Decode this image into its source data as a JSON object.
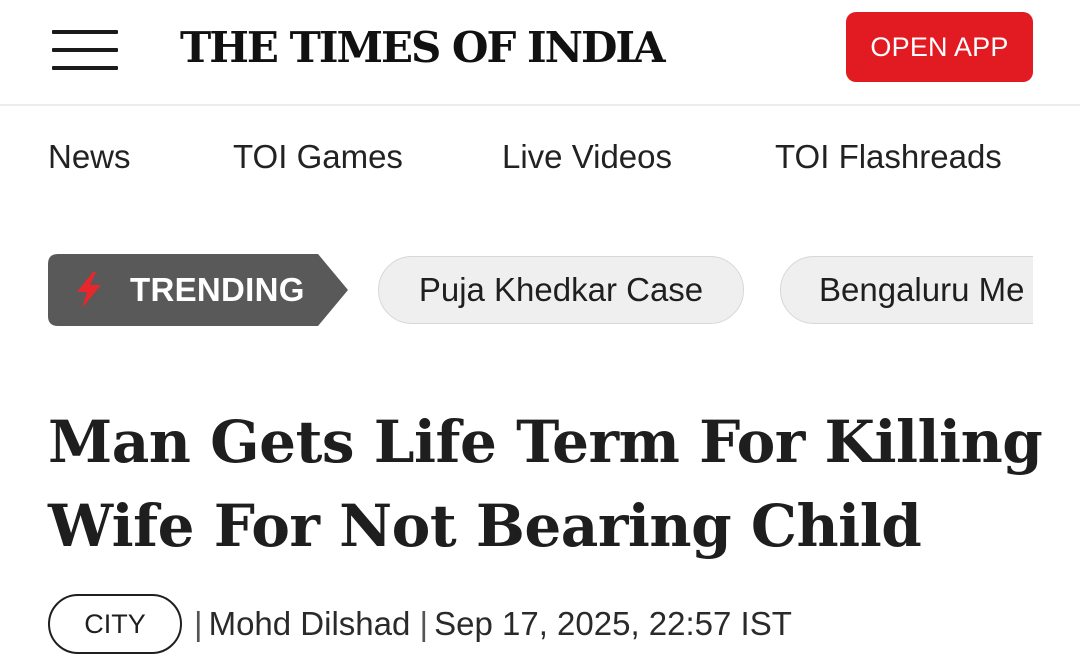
{
  "header": {
    "logo_text": "THE TIMES OF INDIA",
    "open_app_label": "OPEN APP",
    "menu_icon": "hamburger-menu-icon"
  },
  "subnav": {
    "items": [
      {
        "label": "News"
      },
      {
        "label": "TOI Games"
      },
      {
        "label": "Live Videos"
      },
      {
        "label": "TOI Flashreads"
      }
    ]
  },
  "trending": {
    "label": "TRENDING",
    "icon": "lightning-bolt-icon",
    "chips": [
      {
        "label": "Puja Khedkar Case"
      },
      {
        "label": "Bengaluru Me"
      }
    ]
  },
  "article": {
    "headline_line1": "Man Gets Life Term For Killing",
    "headline_line2": "Wife For Not Bearing Child",
    "category": "CITY",
    "author": "Mohd Dilshad",
    "separator": "|",
    "timestamp": "Sep 17, 2025, 22:57 IST"
  },
  "colors": {
    "brand_red": "#e21b22",
    "trending_bg": "#595959",
    "chip_bg": "#efefef"
  }
}
